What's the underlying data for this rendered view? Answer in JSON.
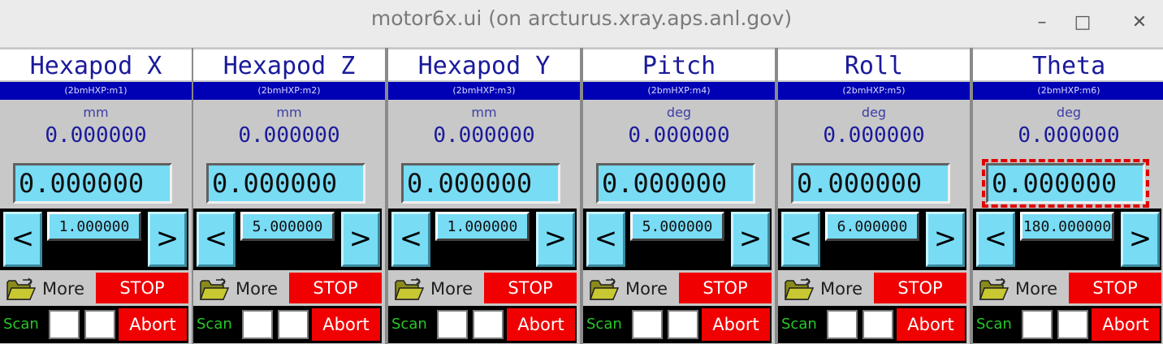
{
  "window": {
    "title": "motor6x.ui (on arcturus.xray.aps.anl.gov)",
    "minimize_glyph": "–",
    "maximize_glyph": "□",
    "close_glyph": "✕"
  },
  "colors": {
    "title_bar": "#ebebeb",
    "pv_bar": "#0000b4",
    "entry_cyan": "#78dcf5",
    "stop_red": "#f00000",
    "scan_green": "#26c826",
    "focus_outline": "#e00000"
  },
  "common": {
    "tweak_left": "<",
    "tweak_right": ">",
    "more_label": "More",
    "stop_label": "STOP",
    "scan_label": "Scan",
    "abort_label": "Abort",
    "more_icon": "folder-open-icon"
  },
  "motors": [
    {
      "name": "Hexapod X",
      "pv": "(2bmHXP:m1)",
      "unit": "mm",
      "readback": "0.000000",
      "setpoint": "0.000000",
      "tweak": "1.000000",
      "focused": false
    },
    {
      "name": "Hexapod Z",
      "pv": "(2bmHXP:m2)",
      "unit": "mm",
      "readback": "0.000000",
      "setpoint": "0.000000",
      "tweak": "5.000000",
      "focused": false
    },
    {
      "name": "Hexapod Y",
      "pv": "(2bmHXP:m3)",
      "unit": "mm",
      "readback": "0.000000",
      "setpoint": "0.000000",
      "tweak": "1.000000",
      "focused": false
    },
    {
      "name": "Pitch",
      "pv": "(2bmHXP:m4)",
      "unit": "deg",
      "readback": "0.000000",
      "setpoint": "0.000000",
      "tweak": "5.000000",
      "focused": false
    },
    {
      "name": "Roll",
      "pv": "(2bmHXP:m5)",
      "unit": "deg",
      "readback": "0.000000",
      "setpoint": "0.000000",
      "tweak": "6.000000",
      "focused": false
    },
    {
      "name": "Theta",
      "pv": "(2bmHXP:m6)",
      "unit": "deg",
      "readback": "0.000000",
      "setpoint": "0.000000",
      "tweak": "180.000000",
      "focused": true
    }
  ]
}
